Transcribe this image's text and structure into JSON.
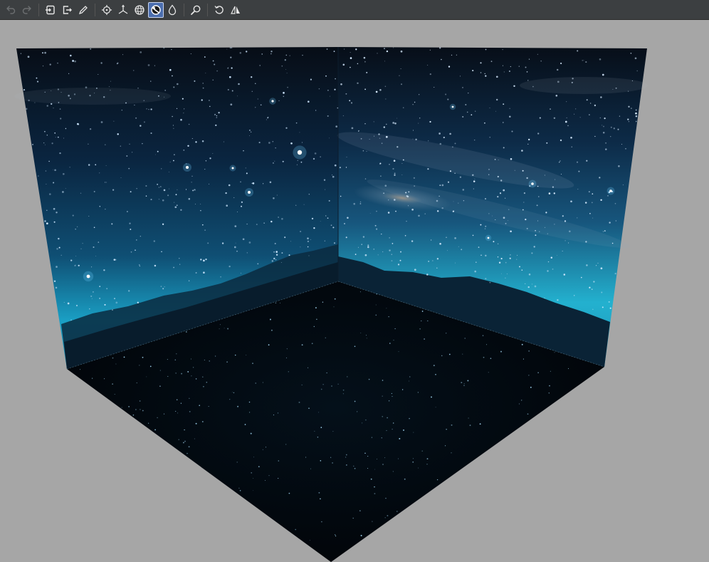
{
  "toolbar": {
    "buttons": [
      {
        "name": "undo-button",
        "icon": "undo-icon",
        "enabled": false
      },
      {
        "name": "redo-button",
        "icon": "redo-icon",
        "enabled": false
      },
      {
        "name": "import-button",
        "icon": "import-icon",
        "enabled": true
      },
      {
        "name": "export-button",
        "icon": "export-icon",
        "enabled": true
      },
      {
        "name": "edit-button",
        "icon": "pencil-icon",
        "enabled": true
      },
      {
        "name": "target-button",
        "icon": "crosshair-icon",
        "enabled": true
      },
      {
        "name": "axes-button",
        "icon": "axes-icon",
        "enabled": true
      },
      {
        "name": "sphere-button",
        "icon": "sphere-icon",
        "enabled": true
      },
      {
        "name": "environment-button",
        "icon": "environment-sphere-icon",
        "enabled": true,
        "active": true
      },
      {
        "name": "drop-button",
        "icon": "drop-icon",
        "enabled": true
      },
      {
        "name": "zoom-button",
        "icon": "zoom-icon",
        "enabled": true
      },
      {
        "name": "reset-button",
        "icon": "rotate-icon",
        "enabled": true
      },
      {
        "name": "mirror-button",
        "icon": "mirror-icon",
        "enabled": true
      }
    ]
  },
  "colors": {
    "toolbar_bg": "#3c3f41",
    "viewport_bg": "#a6a6a6",
    "active_button": "#4b6eaf",
    "sky_top": "#05101c",
    "sky_glow": "#1ea3c4",
    "floor": "#02070d"
  },
  "viewport": {
    "content": "night-sky-environment-cube"
  }
}
